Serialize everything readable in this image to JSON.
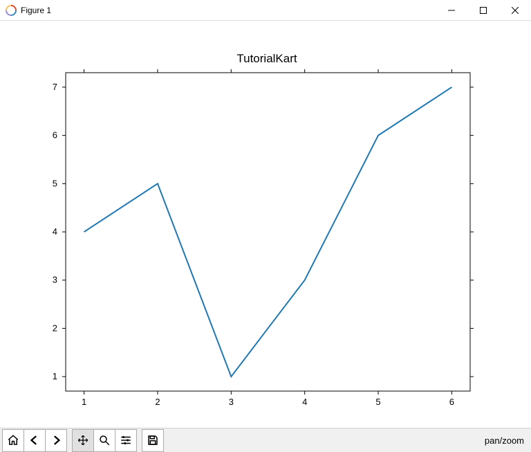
{
  "window": {
    "title": "Figure 1"
  },
  "chart_data": {
    "type": "line",
    "title": "TutorialKart",
    "xlabel": "",
    "ylabel": "",
    "x": [
      1,
      2,
      3,
      4,
      5,
      6
    ],
    "values": [
      4,
      5,
      1,
      3,
      6,
      7
    ],
    "xticks": [
      1,
      2,
      3,
      4,
      5,
      6
    ],
    "yticks": [
      1,
      2,
      3,
      4,
      5,
      6,
      7
    ],
    "xlim": [
      0.75,
      6.25
    ],
    "ylim": [
      0.7,
      7.3
    ]
  },
  "toolbar": {
    "status": "pan/zoom"
  }
}
